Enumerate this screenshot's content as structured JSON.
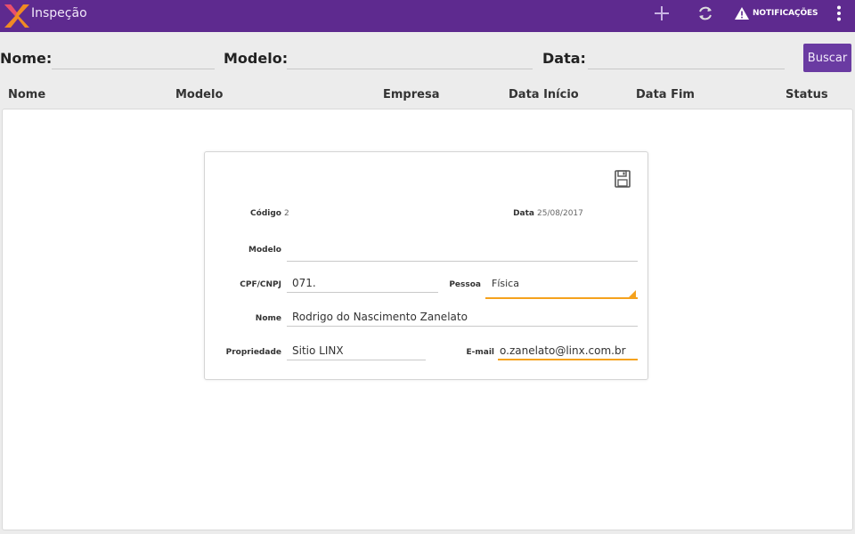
{
  "app": {
    "title": "Inspeção"
  },
  "toolbar": {
    "notifications_label": "NOTIFICAÇÕES",
    "icons": [
      "plus-icon",
      "sync-icon",
      "warning-icon",
      "more-vert-icon"
    ]
  },
  "filters": {
    "nome_label": "Nome:",
    "nome_value": "",
    "modelo_label": "Modelo:",
    "modelo_value": "",
    "data_label": "Data:",
    "data_value": "",
    "search_button": "Buscar"
  },
  "table": {
    "columns": [
      "Nome",
      "Modelo",
      "Empresa",
      "Data Início",
      "Data Fim",
      "Status"
    ]
  },
  "form": {
    "codigo_label": "Código",
    "codigo_value": "2",
    "data_label": "Data",
    "data_value": "25/08/2017",
    "modelo_label": "Modelo",
    "modelo_value": "",
    "cpf_label": "CPF/CNPJ",
    "cpf_value": "071.",
    "pessoa_label": "Pessoa",
    "pessoa_value": "Física",
    "nome_label": "Nome",
    "nome_value": "Rodrigo do Nascimento Zanelato",
    "propriedade_label": "Propriedade",
    "propriedade_value": "Sitio LINX",
    "email_label": "E-mail",
    "email_value": "o.zanelato@linx.com.br"
  },
  "colors": {
    "appbar": "#5e2a8f",
    "button": "#6a3ba2",
    "accent": "#f5a21d"
  }
}
